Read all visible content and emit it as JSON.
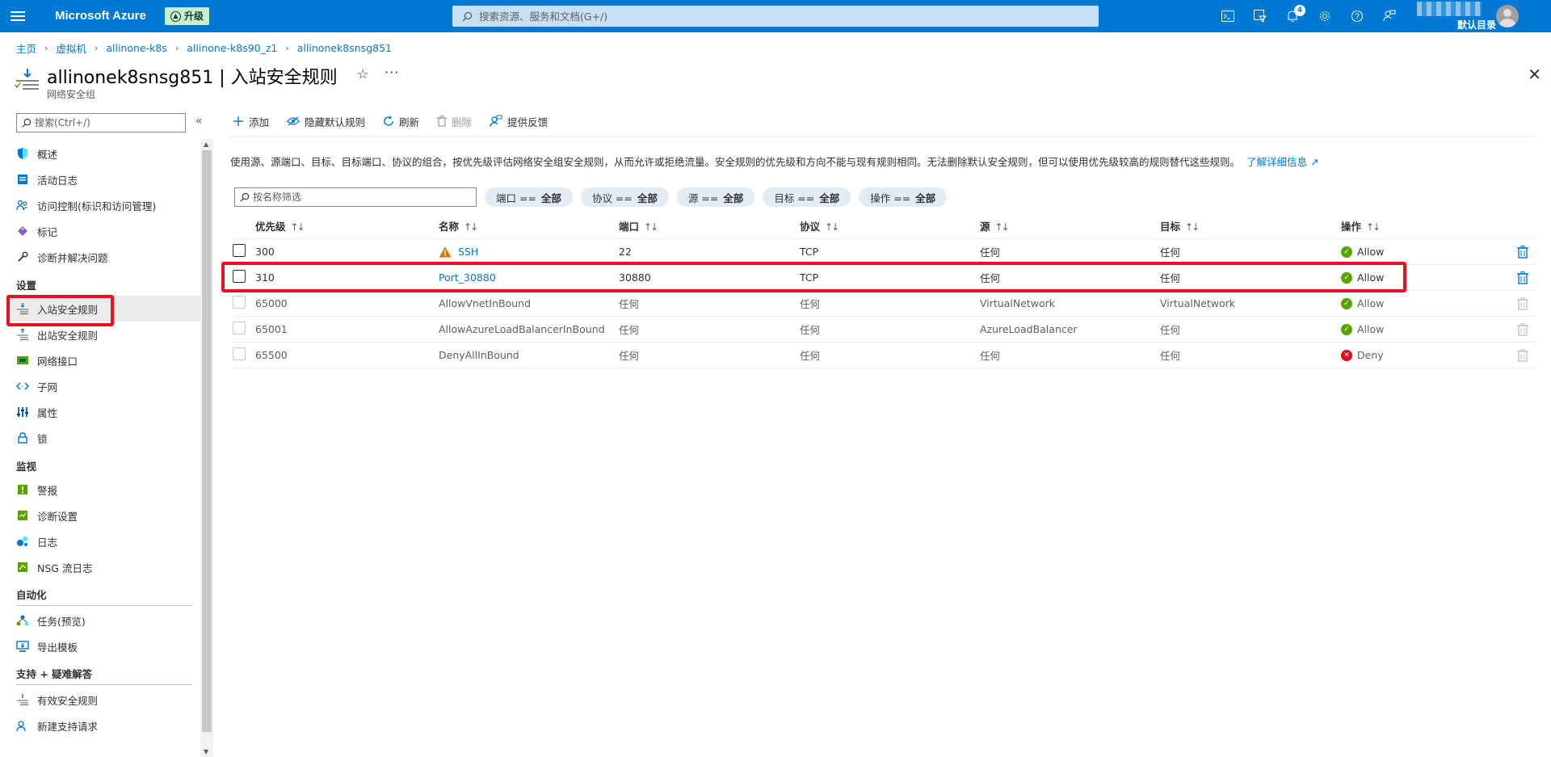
{
  "topbar": {
    "brand": "Microsoft Azure",
    "upgrade_label": "升级",
    "search_placeholder": "搜索资源、服务和文档(G+/)",
    "notification_count": "4",
    "directory": "默认目录"
  },
  "breadcrumb": [
    "主页",
    "虚拟机",
    "allinone-k8s",
    "allinone-k8s90_z1",
    "allinonek8snsg851"
  ],
  "header": {
    "title": "allinonek8snsg851 | 入站安全规则",
    "subtitle": "网络安全组"
  },
  "nav": {
    "search_placeholder": "搜索(Ctrl+/)",
    "top_items": [
      {
        "label": "概述",
        "icon": "shield-icon"
      },
      {
        "label": "活动日志",
        "icon": "activity-log-icon"
      },
      {
        "label": "访问控制(标识和访问管理)",
        "icon": "people-icon"
      },
      {
        "label": "标记",
        "icon": "tag-icon"
      },
      {
        "label": "诊断并解决问题",
        "icon": "wrench-icon"
      }
    ],
    "section_settings": "设置",
    "settings_items": [
      {
        "label": "入站安全规则",
        "icon": "inbound-rules-icon"
      },
      {
        "label": "出站安全规则",
        "icon": "outbound-rules-icon"
      },
      {
        "label": "网络接口",
        "icon": "network-interface-icon"
      },
      {
        "label": "子网",
        "icon": "subnet-icon"
      },
      {
        "label": "属性",
        "icon": "properties-icon"
      },
      {
        "label": "锁",
        "icon": "lock-icon"
      }
    ],
    "section_monitor": "监视",
    "monitor_items": [
      {
        "label": "警报",
        "icon": "alert-icon"
      },
      {
        "label": "诊断设置",
        "icon": "diagnostic-settings-icon"
      },
      {
        "label": "日志",
        "icon": "logs-icon"
      },
      {
        "label": "NSG 流日志",
        "icon": "flow-log-icon"
      }
    ],
    "section_automation": "自动化",
    "automation_items": [
      {
        "label": "任务(预览)",
        "icon": "tasks-icon"
      },
      {
        "label": "导出模板",
        "icon": "export-template-icon"
      }
    ],
    "section_support": "支持 + 疑难解答",
    "support_items": [
      {
        "label": "有效安全规则",
        "icon": "effective-rules-icon"
      },
      {
        "label": "新建支持请求",
        "icon": "support-request-icon"
      }
    ]
  },
  "toolbar": {
    "add": "添加",
    "hide_default": "隐藏默认规则",
    "refresh": "刷新",
    "delete": "删除",
    "feedback": "提供反馈"
  },
  "description": {
    "text": "使用源、源端口、目标、目标端口、协议的组合，按优先级评估网络安全组安全规则，从而允许或拒绝流量。安全规则的优先级和方向不能与现有规则相同。无法删除默认安全规则，但可以使用优先级较高的规则替代这些规则。",
    "link": "了解详细信息"
  },
  "filters": {
    "name_placeholder": "按名称筛选",
    "pills": [
      {
        "key": "端口 ==",
        "value": "全部"
      },
      {
        "key": "协议 ==",
        "value": "全部"
      },
      {
        "key": "源 ==",
        "value": "全部"
      },
      {
        "key": "目标 ==",
        "value": "全部"
      },
      {
        "key": "操作 ==",
        "value": "全部"
      }
    ]
  },
  "table": {
    "columns": [
      "优先级",
      "名称",
      "端口",
      "协议",
      "源",
      "目标",
      "操作"
    ],
    "rows": [
      {
        "priority": "300",
        "name": "SSH",
        "port": "22",
        "protocol": "TCP",
        "source": "任何",
        "destination": "任何",
        "action": "Allow"
      },
      {
        "priority": "310",
        "name": "Port_30880",
        "port": "30880",
        "protocol": "TCP",
        "source": "任何",
        "destination": "任何",
        "action": "Allow"
      },
      {
        "priority": "65000",
        "name": "AllowVnetInBound",
        "port": "任何",
        "protocol": "任何",
        "source": "VirtualNetwork",
        "destination": "VirtualNetwork",
        "action": "Allow"
      },
      {
        "priority": "65001",
        "name": "AllowAzureLoadBalancerInBound",
        "port": "任何",
        "protocol": "任何",
        "source": "AzureLoadBalancer",
        "destination": "任何",
        "action": "Allow"
      },
      {
        "priority": "65500",
        "name": "DenyAllInBound",
        "port": "任何",
        "protocol": "任何",
        "source": "任何",
        "destination": "任何",
        "action": "Deny"
      }
    ]
  },
  "colors": {
    "azure_blue": "#0078d4",
    "allow_green": "#57a300",
    "deny_red": "#e00b1c",
    "highlight_red": "#e81123"
  }
}
